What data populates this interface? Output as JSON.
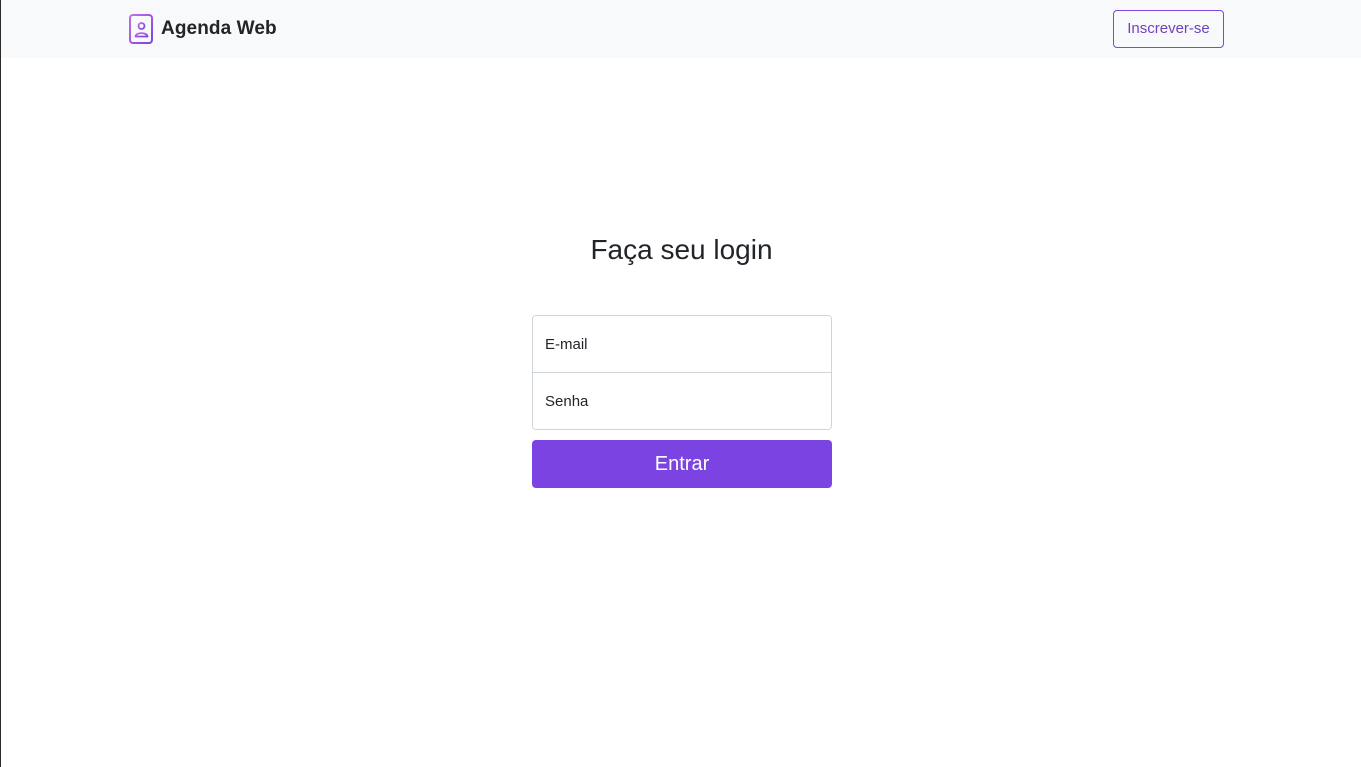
{
  "navbar": {
    "brand_icon": "address-book-icon",
    "brand_name": "Agenda Web",
    "signup_label": "Inscrever-se"
  },
  "login": {
    "title": "Faça seu login",
    "email_placeholder": "E-mail",
    "password_placeholder": "Senha",
    "submit_label": "Entrar"
  },
  "colors": {
    "accent": "#7b44e2",
    "navbar_bg": "#f8f9fa",
    "text": "#212529",
    "border": "#ced4da"
  }
}
